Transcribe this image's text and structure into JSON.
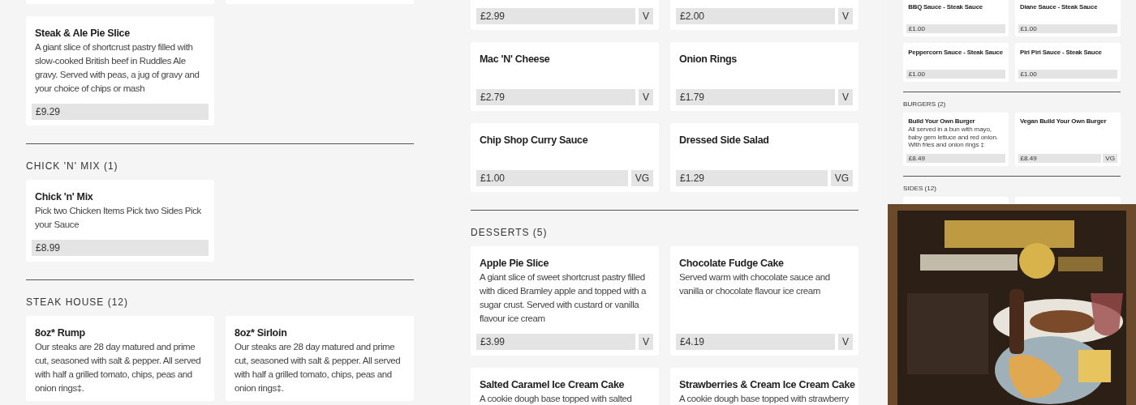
{
  "columns": [
    {
      "sections": [
        {
          "items": [
            {
              "kind": "cut"
            },
            {
              "kind": "cut"
            },
            {
              "kind": "item",
              "name": "Steak & Ale Pie Slice",
              "description": "A giant slice of shortcrust pastry filled with slow-cooked British beef in Ruddles Ale gravy. Served with peas, a jug of gravy and your choice of chips or mash",
              "price": "£9.29"
            }
          ]
        },
        {
          "heading": "CHICK 'N' MIX (1)",
          "items": [
            {
              "kind": "item",
              "name": "Chick 'n' Mix",
              "description": "Pick two Chicken Items Pick two Sides Pick your Sauce",
              "price": "£8.99"
            }
          ]
        },
        {
          "heading": "STEAK HOUSE (12)",
          "items": [
            {
              "kind": "item",
              "name": "8oz* Rump",
              "description": "Our steaks are 28 day matured and prime cut, seasoned with salt & pepper. All served with half a grilled tomato, chips, peas and onion rings‡."
            },
            {
              "kind": "item",
              "name": "8oz* Sirloin",
              "description": "Our steaks are 28 day matured and prime cut, seasoned with salt & pepper. All served with half a grilled tomato, chips, peas and onion rings‡."
            }
          ]
        }
      ]
    },
    {
      "sections": [
        {
          "items": [
            {
              "kind": "tail",
              "price": "£2.99",
              "tag": "V"
            },
            {
              "kind": "tail",
              "price": "£2.00",
              "tag": "V"
            },
            {
              "kind": "item",
              "name": "Mac 'N' Cheese",
              "price": "£2.79",
              "tag": "V"
            },
            {
              "kind": "item",
              "name": "Onion Rings",
              "price": "£1.79",
              "tag": "V"
            },
            {
              "kind": "item",
              "name": "Chip Shop Curry Sauce",
              "price": "£1.00",
              "tag": "VG"
            },
            {
              "kind": "item",
              "name": "Dressed Side Salad",
              "price": "£1.29",
              "tag": "VG"
            }
          ]
        },
        {
          "heading": "DESSERTS (5)",
          "items": [
            {
              "kind": "item",
              "name": "Apple Pie Slice",
              "description": "A giant slice of sweet shortcrust pastry filled with diced Bramley apple and topped with a sugar crust. Served with custard or vanilla flavour ice cream",
              "price": "£3.99",
              "tag": "V"
            },
            {
              "kind": "item",
              "name": "Chocolate Fudge Cake",
              "description": "Served warm with chocolate sauce and vanilla or chocolate flavour ice cream",
              "price": "£4.19",
              "tag": "V"
            },
            {
              "kind": "item",
              "name": "Salted Caramel Ice Cream Cake",
              "description": "A cookie dough base topped with salted"
            },
            {
              "kind": "item",
              "name": "Strawberries & Cream Ice Cream Cake",
              "description": "A cookie dough base topped with strawberry"
            }
          ]
        }
      ]
    }
  ],
  "preview": {
    "sections": [
      {
        "items": [
          {
            "kind": "item",
            "name": "BBQ Sauce - Steak Sauce",
            "price": "£1.00"
          },
          {
            "kind": "item",
            "name": "Diane Sauce - Steak Sauce",
            "price": "£1.00"
          },
          {
            "kind": "item",
            "name": "Peppercorn Sauce - Steak Sauce",
            "price": "£1.00"
          },
          {
            "kind": "item",
            "name": "Piri Piri Sauce - Steak Sauce",
            "price": "£1.00"
          }
        ]
      },
      {
        "heading": "BURGERS (2)",
        "items": [
          {
            "kind": "item",
            "name": "Build Your Own Burger",
            "description": "All served in a bun with mayo, baby gem lettuce and red onion. With fries and onion rings ‡",
            "price": "£8.49"
          },
          {
            "kind": "item",
            "name": "Vegan Build Your Own Burger",
            "price": "£8.49",
            "tag": "VG"
          }
        ]
      },
      {
        "heading": "SIDES (12)",
        "items": [
          {
            "kind": "cut"
          },
          {
            "kind": "cut"
          }
        ]
      }
    ]
  }
}
